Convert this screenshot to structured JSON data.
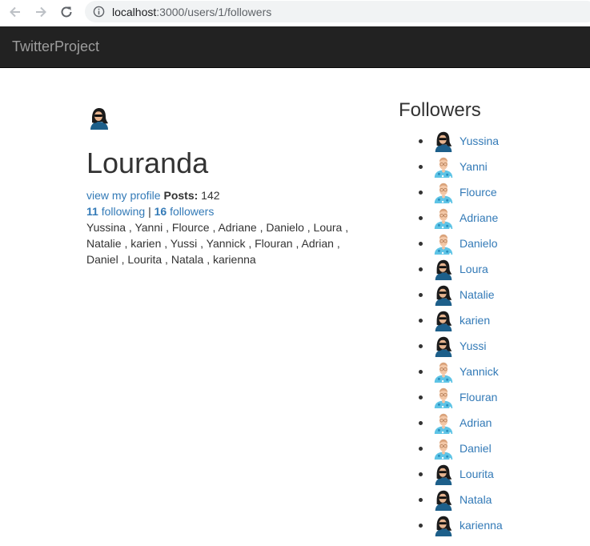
{
  "browser": {
    "url_host": "localhost",
    "url_path": ":3000/users/1/followers"
  },
  "navbar": {
    "brand": "TwitterProject"
  },
  "profile": {
    "name": "Louranda",
    "view_profile_label": "view my profile",
    "posts_label": "Posts:",
    "posts_count": "142",
    "following_count": "11",
    "following_label": "following",
    "separator": "|",
    "followers_count": "16",
    "followers_label": "followers",
    "followers_line_1": "Yussina , Yanni , Flource , Adriane , Danielo , Loura ,",
    "followers_line_2": "Natalie , karien , Yussi , Yannick , Flouran , Adrian ,",
    "followers_line_3": "Daniel , Lourita , Natala , karienna"
  },
  "followers_panel": {
    "title": "Followers",
    "items": [
      {
        "name": "Yussina",
        "avatar": "woman-avatar-icon"
      },
      {
        "name": "Yanni",
        "avatar": "man-avatar-icon"
      },
      {
        "name": "Flource",
        "avatar": "man-avatar-icon"
      },
      {
        "name": "Adriane",
        "avatar": "man-avatar-icon"
      },
      {
        "name": "Danielo",
        "avatar": "man-avatar-icon"
      },
      {
        "name": "Loura",
        "avatar": "woman-avatar-icon"
      },
      {
        "name": "Natalie",
        "avatar": "woman-avatar-icon"
      },
      {
        "name": "karien",
        "avatar": "woman-avatar-icon"
      },
      {
        "name": "Yussi",
        "avatar": "woman-avatar-icon"
      },
      {
        "name": "Yannick",
        "avatar": "man-avatar-icon"
      },
      {
        "name": "Flouran",
        "avatar": "man-avatar-icon"
      },
      {
        "name": "Adrian",
        "avatar": "man-avatar-icon"
      },
      {
        "name": "Daniel",
        "avatar": "man-avatar-icon"
      },
      {
        "name": "Lourita",
        "avatar": "woman-avatar-icon"
      },
      {
        "name": "Natala",
        "avatar": "woman-avatar-icon"
      },
      {
        "name": "karienna",
        "avatar": "woman-avatar-icon"
      }
    ]
  },
  "colors": {
    "navbar_bg": "#222222",
    "brand_text": "#9d9d9d",
    "link": "#337ab7",
    "text": "#333333"
  }
}
